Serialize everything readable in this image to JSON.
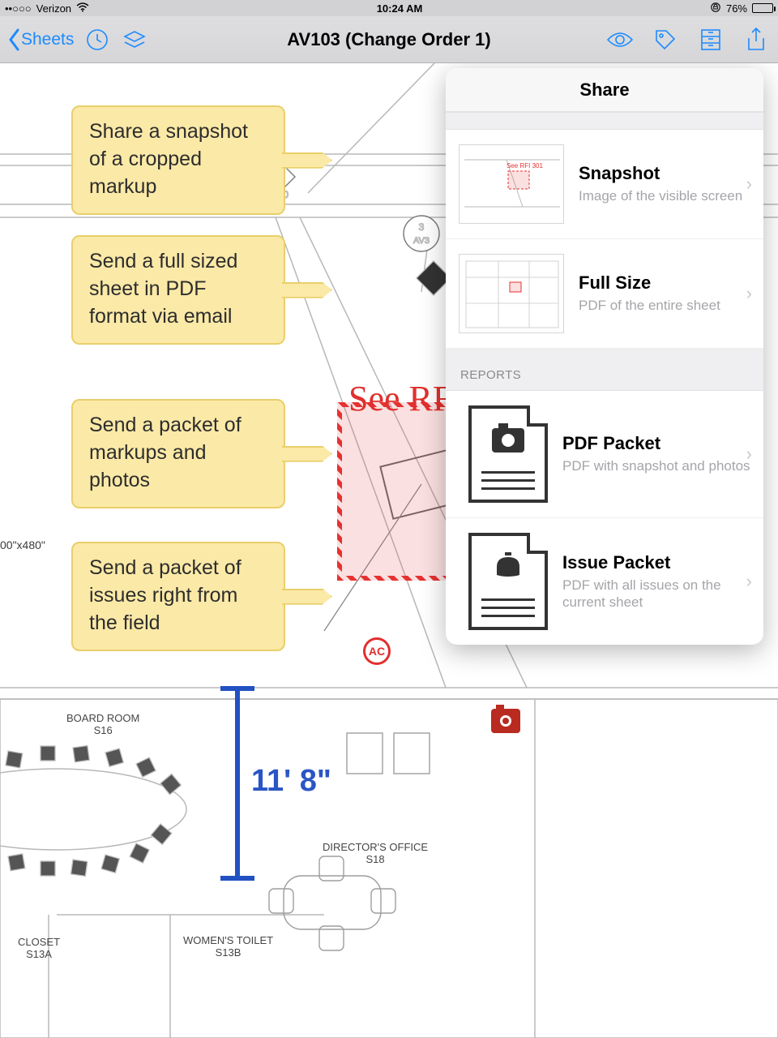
{
  "statusbar": {
    "signal": "••○○○",
    "carrier": "Verizon",
    "time": "10:24 AM",
    "battery_pct": "76%"
  },
  "navbar": {
    "back": "Sheets",
    "title": "AV103 (Change Order 1)"
  },
  "annotations": [
    "Share a snapshot of a cropped markup",
    "Send a full sized sheet in PDF format via email",
    "Send a packet of markups and photos",
    "Send a packet of issues right from the field"
  ],
  "share": {
    "header": "Share",
    "sections": [
      {
        "label": null,
        "items": [
          {
            "title": "Snapshot",
            "subtitle": "Image of the visible screen",
            "icon": "thumb"
          },
          {
            "title": "Full Size",
            "subtitle": "PDF of the entire sheet",
            "icon": "thumb"
          }
        ]
      },
      {
        "label": "REPORTS",
        "items": [
          {
            "title": "PDF Packet",
            "subtitle": "PDF with snapshot and photos",
            "icon": "file-camera"
          },
          {
            "title": "Issue Packet",
            "subtitle": "PDF with all issues on the current sheet",
            "icon": "file-punch"
          }
        ]
      }
    ]
  },
  "markup": {
    "rfi_text": "See RF",
    "dimension": "11' 8\"",
    "ac": "AC"
  },
  "rooms": {
    "board": {
      "name": "BOARD ROOM",
      "code": "S16"
    },
    "director": {
      "name": "DIRECTOR'S OFFICE",
      "code": "S18"
    },
    "closet": {
      "name": "CLOSET",
      "code": "S13A"
    },
    "toilet": {
      "name": "WOMEN'S TOILET",
      "code": "S13B"
    }
  },
  "side_dim": "00\"x480\""
}
